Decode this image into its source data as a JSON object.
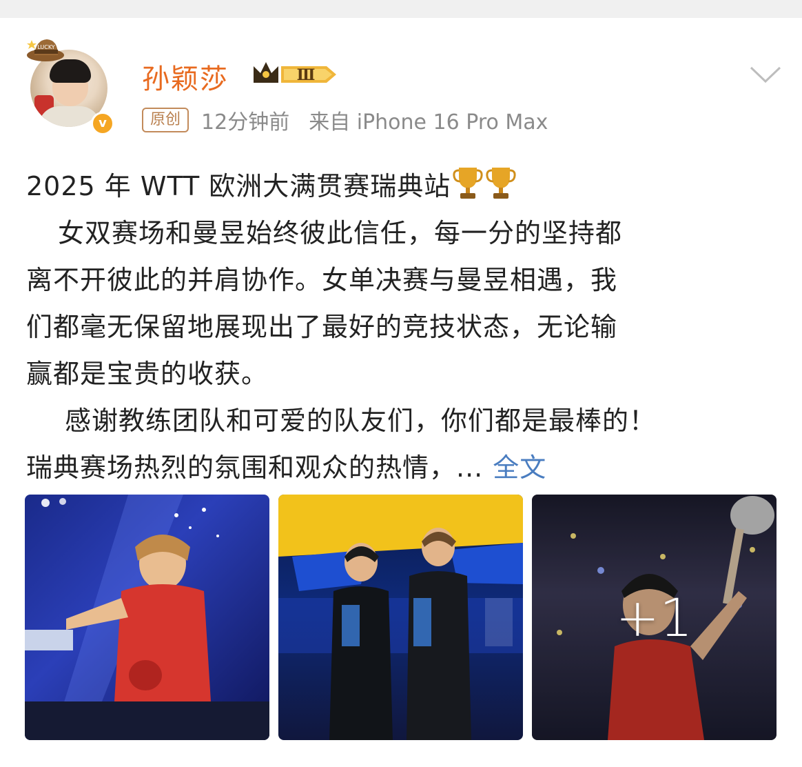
{
  "post": {
    "author": {
      "name": "孙颖莎",
      "vip_level": "Ⅲ",
      "verified_mark": "v",
      "avatar_sticker": "LUCKY"
    },
    "tag_original": "原创",
    "time": "12分钟前",
    "source": "来自 iPhone 16 Pro Max",
    "text_lines": [
      "2025 年 WTT 欧洲大满贯赛瑞典站",
      "女双赛场和曼昱始终彼此信任，每一分的坚持都",
      "离不开彼此的并肩协作。女单决赛与曼昱相遇，我",
      "们都毫无保留地展现出了最好的竞技状态，无论输",
      "赢都是宝贵的收获。",
      "感谢教练团队和可爱的队友们，你们都是最棒的！",
      "瑞典赛场热烈的氛围和观众的热情，..."
    ],
    "full_text_link": "全文",
    "more_photos": "+1"
  },
  "icons": {
    "trophy": "trophy-icon",
    "chevron": "chevron-down-icon",
    "crown": "crown-icon"
  },
  "colors": {
    "username": "#e86a1f",
    "link": "#4a7dc0",
    "meta": "#8a8a8a"
  }
}
